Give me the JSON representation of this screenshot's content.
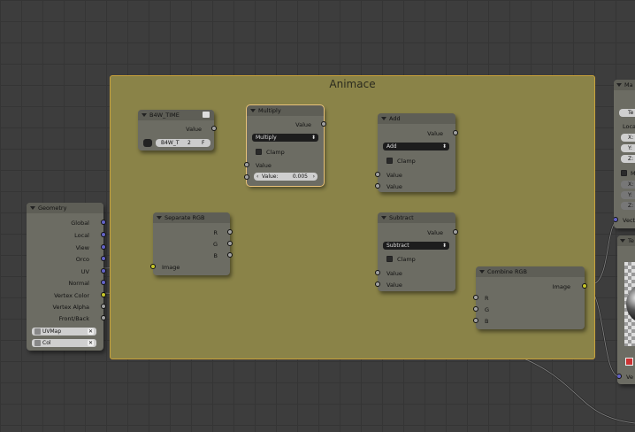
{
  "frame": {
    "label": "Animace"
  },
  "time_node": {
    "title": "B4W_TIME",
    "output": "Value",
    "field": "B4W_T",
    "field_num": "2",
    "field_f": "F"
  },
  "multiply_node": {
    "title": "Multiply",
    "output": "Value",
    "op": "Multiply",
    "clamp": "Clamp",
    "input": "Value",
    "value_label": "Value:",
    "value": "0.005"
  },
  "add_node": {
    "title": "Add",
    "output": "Value",
    "op": "Add",
    "clamp": "Clamp",
    "input1": "Value",
    "input2": "Value"
  },
  "subtract_node": {
    "title": "Subtract",
    "output": "Value",
    "op": "Subtract",
    "clamp": "Clamp",
    "input1": "Value",
    "input2": "Value"
  },
  "separate_node": {
    "title": "Separate RGB",
    "out_r": "R",
    "out_g": "G",
    "out_b": "B",
    "input": "Image"
  },
  "combine_node": {
    "title": "Combine RGB",
    "output": "Image",
    "in_r": "R",
    "in_g": "G",
    "in_b": "B"
  },
  "geometry_node": {
    "title": "Geometry",
    "outputs": [
      "Global",
      "Local",
      "View",
      "Orco",
      "UV",
      "Normal",
      "Vertex Color",
      "Vertex Alpha",
      "Front/Back"
    ],
    "uv_map": "UVMap",
    "color_layer": "Col"
  },
  "right_nodes": {
    "mat_title": "Ma",
    "mat_btn": "Te",
    "mat_local": "Loca",
    "mat_x": "X:",
    "mat_y": "Y:",
    "mat_z": "Z:",
    "mat_m": "M",
    "mat_x2": "X:",
    "mat_y2": "Y:",
    "mat_z2": "Z:",
    "mat_vec": "Vecto",
    "tex_title": "Te",
    "tex_out": "Ve"
  },
  "colors": {
    "color_socket": "#c7c729",
    "value_socket": "#a1a1a1",
    "vector_socket": "#6363c7",
    "frame": "#8a8348"
  }
}
